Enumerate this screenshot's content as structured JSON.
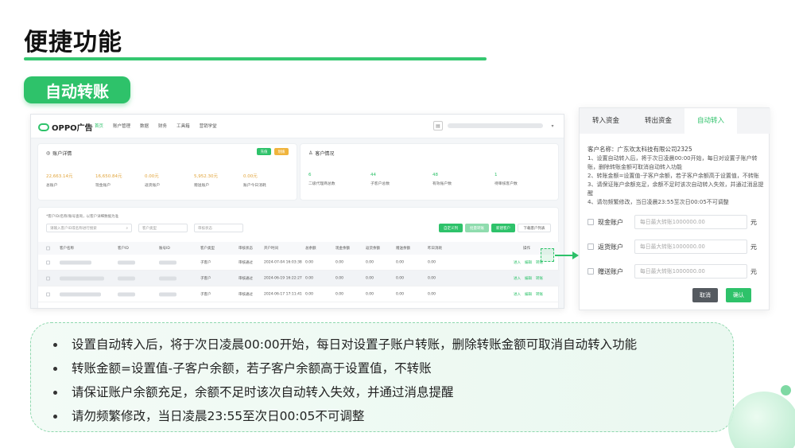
{
  "slide": {
    "title": "便捷功能",
    "badge": "自动转账",
    "accent_color": "#2ec26a"
  },
  "app": {
    "logo_text": "OPPO广告",
    "nav": [
      "首页",
      "账户管理",
      "数据",
      "财务",
      "工具箱",
      "营销学堂"
    ],
    "panel_account": {
      "title": "账户详情",
      "btn_green": "充值",
      "btn_yellow": "划拨",
      "stats": [
        {
          "value": "22,663.14元",
          "label": "总账户"
        },
        {
          "value": "16,650.84元",
          "label": "现金账户"
        },
        {
          "value": "0.00元",
          "label": "返货账户"
        },
        {
          "value": "5,952.30元",
          "label": "赠送账户"
        },
        {
          "value": "0.00元",
          "label": "账户今日消耗"
        }
      ]
    },
    "panel_customer": {
      "title": "客户情况",
      "stats": [
        {
          "value": "6",
          "label": "二级代理商总数"
        },
        {
          "value": "44",
          "label": "子客户总数"
        },
        {
          "value": "48",
          "label": "有效账户数"
        },
        {
          "value": "1",
          "label": "待审核客户数"
        }
      ]
    },
    "table_panel": {
      "hint": "*客户ID/名称/账号查询，以客户详细数据为准",
      "search_placeholder": "请输入客户ID或名称进行搜索",
      "filter_type": "客户类型",
      "filter_status": "审核状态",
      "actions": [
        "自定义列",
        "批量转账",
        "新建客户",
        "下载客户列表"
      ],
      "columns": [
        "客户名称",
        "客户ID",
        "账号ID",
        "客户类型",
        "审核状态",
        "开户时间",
        "总余额",
        "现金余额",
        "返货余额",
        "赠送余额",
        "昨日消耗",
        "操作"
      ],
      "rows": [
        {
          "type": "子客户",
          "status": "审核通过",
          "time": "2024-07-04 16:03:38",
          "total": "0.00",
          "cash": "0.00",
          "return": "0.00",
          "gift": "0.00",
          "cost": "0.00",
          "ops": [
            "进入",
            "编辑",
            "转账"
          ]
        },
        {
          "type": "子客户",
          "status": "审核通过",
          "time": "2024-06-19 16:22:27",
          "total": "0.00",
          "cash": "0.00",
          "return": "0.00",
          "gift": "0.00",
          "cost": "0.00",
          "ops": [
            "进入",
            "编辑",
            "转账"
          ]
        },
        {
          "type": "子客户",
          "status": "审核通过",
          "time": "2024-06-17 17:11:41",
          "total": "0.00",
          "cash": "0.00",
          "return": "0.00",
          "gift": "0.00",
          "cost": "0.00",
          "ops": [
            "进入",
            "编辑",
            "转账"
          ]
        }
      ]
    }
  },
  "dialog": {
    "tabs": [
      "转入资金",
      "转出资金",
      "自动转入"
    ],
    "active_tab": 2,
    "customer_name": "客户名称：广东欢太科技有限公司2325",
    "rules": [
      "1、设置自动转入后，将于次日凌晨00:00开始，每日对设置子账户转账，删除转账金额可取消自动转入功能",
      "2、转账金额=设置值-子客户余额，若子客户余额高于设置值，不转账",
      "3、请保证账户余额充足，余额不足时该次自动转入失效，并通过消息提醒",
      "4、请勿频繁修改，当日凌晨23:55至次日00:05不可调整"
    ],
    "accounts": [
      {
        "label": "现金账户",
        "placeholder": "每日最大转账1000000.00",
        "unit": "元"
      },
      {
        "label": "返货账户",
        "placeholder": "每日最大转账1000000.00",
        "unit": "元"
      },
      {
        "label": "赠送账户",
        "placeholder": "每日最大转账1000000.00",
        "unit": "元"
      }
    ],
    "cancel_label": "取消",
    "confirm_label": "确认"
  },
  "notes": [
    "设置自动转入后，将于次日凌晨00:00开始，每日对设置子账户转账，删除转账金额可取消自动转入功能",
    "转账金额=设置值-子客户余额，若子客户余额高于设置值，不转账",
    "请保证账户余额充足，余额不足时该次自动转入失效，并通过消息提醒",
    "请勿频繁修改，当日凌晨23:55至次日00:05不可调整"
  ]
}
